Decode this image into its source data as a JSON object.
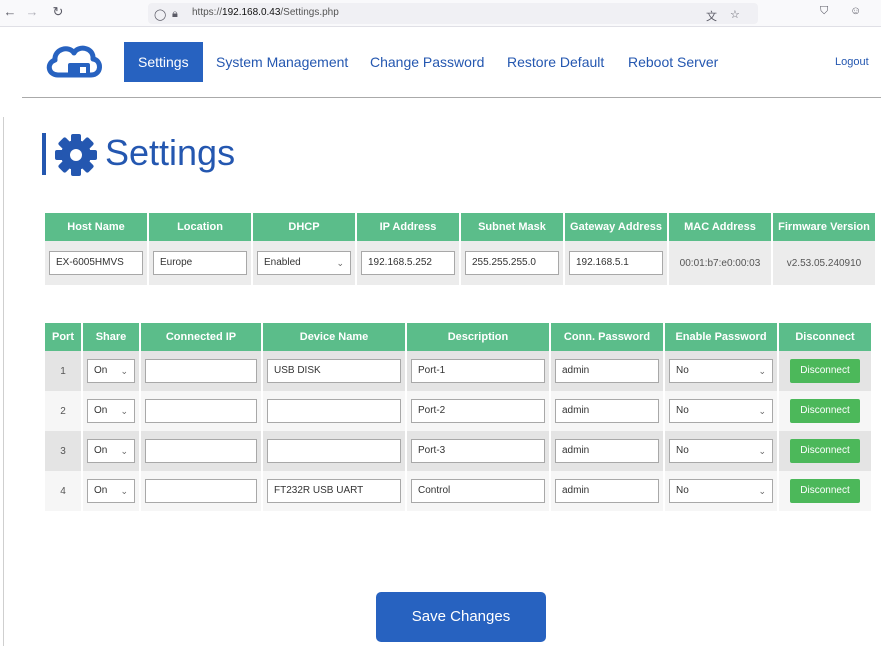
{
  "browser": {
    "url_prefix": "https://",
    "url_host": "192.168.0.43",
    "url_path": "/Settings.php"
  },
  "nav": {
    "items": [
      {
        "label": "Settings",
        "active": true
      },
      {
        "label": "System Management"
      },
      {
        "label": "Change Password"
      },
      {
        "label": "Restore Default"
      },
      {
        "label": "Reboot Server"
      }
    ],
    "logout": "Logout"
  },
  "page_title": "Settings",
  "info": {
    "headers": [
      "Host Name",
      "Location",
      "DHCP",
      "IP Address",
      "Subnet Mask",
      "Gateway Address",
      "MAC Address",
      "Firmware Version"
    ],
    "host_name": "EX-6005HMVS",
    "location": "Europe",
    "dhcp": "Enabled",
    "ip_address": "192.168.5.252",
    "subnet_mask": "255.255.255.0",
    "gateway": "192.168.5.1",
    "mac_address": "00:01:b7:e0:00:03",
    "firmware": "v2.53.05.240910"
  },
  "ports": {
    "headers": [
      "Port",
      "Share",
      "Connected IP",
      "Device Name",
      "Description",
      "Conn. Password",
      "Enable Password",
      "Disconnect"
    ],
    "rows": [
      {
        "port": "1",
        "share": "On",
        "connected_ip": "",
        "device_name": "USB DISK",
        "description": "Port-1",
        "password": "admin",
        "enable_password": "No",
        "disconnect": "Disconnect"
      },
      {
        "port": "2",
        "share": "On",
        "connected_ip": "",
        "device_name": "",
        "description": "Port-2",
        "password": "admin",
        "enable_password": "No",
        "disconnect": "Disconnect"
      },
      {
        "port": "3",
        "share": "On",
        "connected_ip": "",
        "device_name": "",
        "description": "Port-3",
        "password": "admin",
        "enable_password": "No",
        "disconnect": "Disconnect"
      },
      {
        "port": "4",
        "share": "On",
        "connected_ip": "",
        "device_name": "FT232R USB UART",
        "description": "Control",
        "password": "admin",
        "enable_password": "No",
        "disconnect": "Disconnect"
      }
    ]
  },
  "save_label": "Save Changes",
  "colors": {
    "brand_blue": "#2762c0",
    "header_green": "#5bbd8a",
    "button_green": "#4cb85a"
  }
}
